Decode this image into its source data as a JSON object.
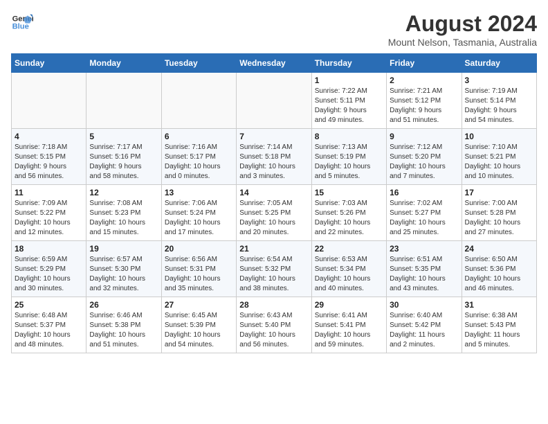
{
  "header": {
    "logo_line1": "General",
    "logo_line2": "Blue",
    "title": "August 2024",
    "subtitle": "Mount Nelson, Tasmania, Australia"
  },
  "columns": [
    "Sunday",
    "Monday",
    "Tuesday",
    "Wednesday",
    "Thursday",
    "Friday",
    "Saturday"
  ],
  "weeks": [
    [
      {
        "day": "",
        "info": ""
      },
      {
        "day": "",
        "info": ""
      },
      {
        "day": "",
        "info": ""
      },
      {
        "day": "",
        "info": ""
      },
      {
        "day": "1",
        "info": "Sunrise: 7:22 AM\nSunset: 5:11 PM\nDaylight: 9 hours\nand 49 minutes."
      },
      {
        "day": "2",
        "info": "Sunrise: 7:21 AM\nSunset: 5:12 PM\nDaylight: 9 hours\nand 51 minutes."
      },
      {
        "day": "3",
        "info": "Sunrise: 7:19 AM\nSunset: 5:14 PM\nDaylight: 9 hours\nand 54 minutes."
      }
    ],
    [
      {
        "day": "4",
        "info": "Sunrise: 7:18 AM\nSunset: 5:15 PM\nDaylight: 9 hours\nand 56 minutes."
      },
      {
        "day": "5",
        "info": "Sunrise: 7:17 AM\nSunset: 5:16 PM\nDaylight: 9 hours\nand 58 minutes."
      },
      {
        "day": "6",
        "info": "Sunrise: 7:16 AM\nSunset: 5:17 PM\nDaylight: 10 hours\nand 0 minutes."
      },
      {
        "day": "7",
        "info": "Sunrise: 7:14 AM\nSunset: 5:18 PM\nDaylight: 10 hours\nand 3 minutes."
      },
      {
        "day": "8",
        "info": "Sunrise: 7:13 AM\nSunset: 5:19 PM\nDaylight: 10 hours\nand 5 minutes."
      },
      {
        "day": "9",
        "info": "Sunrise: 7:12 AM\nSunset: 5:20 PM\nDaylight: 10 hours\nand 7 minutes."
      },
      {
        "day": "10",
        "info": "Sunrise: 7:10 AM\nSunset: 5:21 PM\nDaylight: 10 hours\nand 10 minutes."
      }
    ],
    [
      {
        "day": "11",
        "info": "Sunrise: 7:09 AM\nSunset: 5:22 PM\nDaylight: 10 hours\nand 12 minutes."
      },
      {
        "day": "12",
        "info": "Sunrise: 7:08 AM\nSunset: 5:23 PM\nDaylight: 10 hours\nand 15 minutes."
      },
      {
        "day": "13",
        "info": "Sunrise: 7:06 AM\nSunset: 5:24 PM\nDaylight: 10 hours\nand 17 minutes."
      },
      {
        "day": "14",
        "info": "Sunrise: 7:05 AM\nSunset: 5:25 PM\nDaylight: 10 hours\nand 20 minutes."
      },
      {
        "day": "15",
        "info": "Sunrise: 7:03 AM\nSunset: 5:26 PM\nDaylight: 10 hours\nand 22 minutes."
      },
      {
        "day": "16",
        "info": "Sunrise: 7:02 AM\nSunset: 5:27 PM\nDaylight: 10 hours\nand 25 minutes."
      },
      {
        "day": "17",
        "info": "Sunrise: 7:00 AM\nSunset: 5:28 PM\nDaylight: 10 hours\nand 27 minutes."
      }
    ],
    [
      {
        "day": "18",
        "info": "Sunrise: 6:59 AM\nSunset: 5:29 PM\nDaylight: 10 hours\nand 30 minutes."
      },
      {
        "day": "19",
        "info": "Sunrise: 6:57 AM\nSunset: 5:30 PM\nDaylight: 10 hours\nand 32 minutes."
      },
      {
        "day": "20",
        "info": "Sunrise: 6:56 AM\nSunset: 5:31 PM\nDaylight: 10 hours\nand 35 minutes."
      },
      {
        "day": "21",
        "info": "Sunrise: 6:54 AM\nSunset: 5:32 PM\nDaylight: 10 hours\nand 38 minutes."
      },
      {
        "day": "22",
        "info": "Sunrise: 6:53 AM\nSunset: 5:34 PM\nDaylight: 10 hours\nand 40 minutes."
      },
      {
        "day": "23",
        "info": "Sunrise: 6:51 AM\nSunset: 5:35 PM\nDaylight: 10 hours\nand 43 minutes."
      },
      {
        "day": "24",
        "info": "Sunrise: 6:50 AM\nSunset: 5:36 PM\nDaylight: 10 hours\nand 46 minutes."
      }
    ],
    [
      {
        "day": "25",
        "info": "Sunrise: 6:48 AM\nSunset: 5:37 PM\nDaylight: 10 hours\nand 48 minutes."
      },
      {
        "day": "26",
        "info": "Sunrise: 6:46 AM\nSunset: 5:38 PM\nDaylight: 10 hours\nand 51 minutes."
      },
      {
        "day": "27",
        "info": "Sunrise: 6:45 AM\nSunset: 5:39 PM\nDaylight: 10 hours\nand 54 minutes."
      },
      {
        "day": "28",
        "info": "Sunrise: 6:43 AM\nSunset: 5:40 PM\nDaylight: 10 hours\nand 56 minutes."
      },
      {
        "day": "29",
        "info": "Sunrise: 6:41 AM\nSunset: 5:41 PM\nDaylight: 10 hours\nand 59 minutes."
      },
      {
        "day": "30",
        "info": "Sunrise: 6:40 AM\nSunset: 5:42 PM\nDaylight: 11 hours\nand 2 minutes."
      },
      {
        "day": "31",
        "info": "Sunrise: 6:38 AM\nSunset: 5:43 PM\nDaylight: 11 hours\nand 5 minutes."
      }
    ]
  ]
}
